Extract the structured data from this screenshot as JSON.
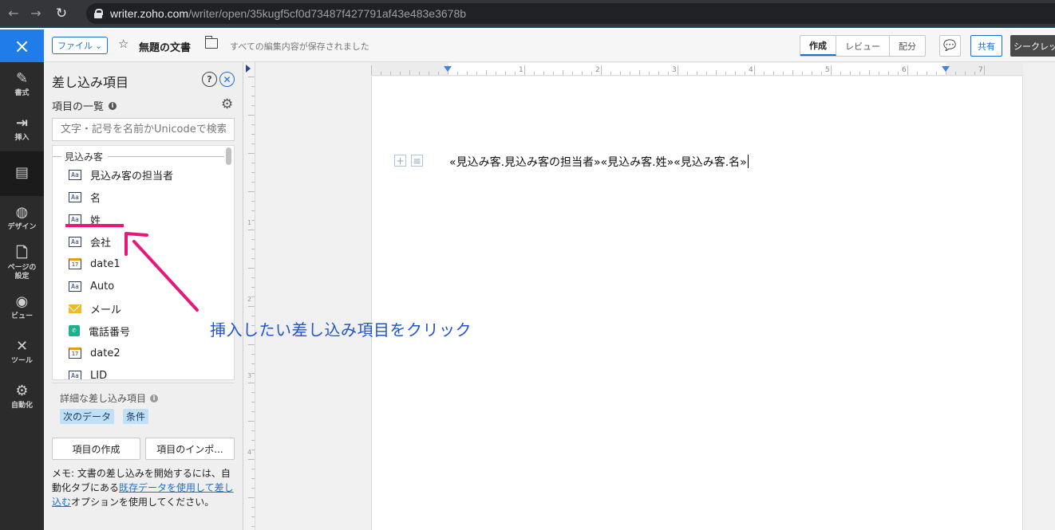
{
  "browser": {
    "url_host": "writer.zoho.com",
    "url_path": "/writer/open/35kugf5cf0d73487f427791af43e483e3678b"
  },
  "rail": {
    "close_icon": "×",
    "items": [
      {
        "label": "書式",
        "icon": "✎"
      },
      {
        "label": "挿入",
        "icon": "⇥"
      },
      {
        "label": "",
        "icon": "▤"
      },
      {
        "label": "デザイン",
        "icon": "◍"
      },
      {
        "label": "ページの設定",
        "icon": "🗋"
      },
      {
        "label": "ビュー",
        "icon": "◉"
      },
      {
        "label": "ツール",
        "icon": "✕"
      },
      {
        "label": "自動化",
        "icon": "⚙"
      }
    ]
  },
  "toolbar": {
    "file_label": "ファイル",
    "doc_title": "無題の文書",
    "save_status": "すべての編集内容が保存されました",
    "tabs": [
      "作成",
      "レビュー",
      "配分"
    ],
    "share_label": "共有",
    "secret_label": "シークレット"
  },
  "panel": {
    "title": "差し込み項目",
    "list_heading": "項目の一覧",
    "search_placeholder": "文字・記号を名前かUnicodeで検索",
    "group_label": "見込み客",
    "fields": [
      {
        "label": "見込み客の担当者",
        "type": "text",
        "icon_text": "Aa"
      },
      {
        "label": "名",
        "type": "text",
        "icon_text": "Aa"
      },
      {
        "label": "姓",
        "type": "text",
        "icon_text": "Aa"
      },
      {
        "label": "会社",
        "type": "text",
        "icon_text": "Aa"
      },
      {
        "label": "date1",
        "type": "date",
        "icon_text": "17"
      },
      {
        "label": "Auto",
        "type": "text",
        "icon_text": "Aa"
      },
      {
        "label": "メール",
        "type": "mail",
        "icon_text": ""
      },
      {
        "label": "電話番号",
        "type": "phone",
        "icon_text": "✆"
      },
      {
        "label": "date2",
        "type": "date",
        "icon_text": "17"
      },
      {
        "label": "LID",
        "type": "text",
        "icon_text": "Aa"
      }
    ],
    "detail_title": "詳細な差し込み項目",
    "chips": [
      "次のデータ",
      "条件"
    ],
    "create_button": "項目の作成",
    "import_button": "項目のインポ...",
    "memo_prefix": "メモ: 文書の差し込みを開始するには、自動化タブにある",
    "memo_link": "既存データを使用して差し込む",
    "memo_suffix": "オプションを使用してください。"
  },
  "document": {
    "merge_text": "«見込み客.見込み客の担当者»«見込み客.姓»«見込み客.名»"
  },
  "ruler": {
    "numbers": [
      "1",
      "2",
      "3",
      "4",
      "5",
      "6",
      "7"
    ],
    "vnumbers": [
      "1",
      "2",
      "3",
      "4"
    ]
  },
  "annotation": {
    "text": "挿入したい差し込み項目をクリック",
    "color": "#e8177a",
    "text_color": "#2255cc"
  }
}
